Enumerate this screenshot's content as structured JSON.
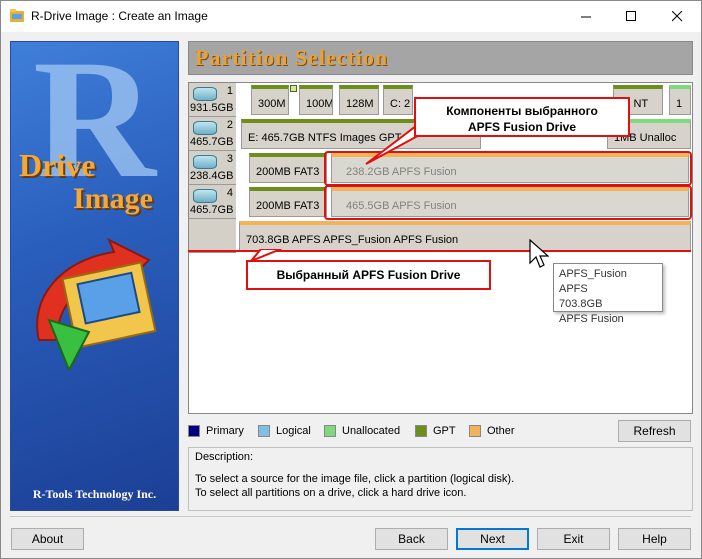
{
  "window": {
    "title": "R-Drive Image : Create an Image"
  },
  "sidebar": {
    "logo_r": "R",
    "logo_drive": "Drive",
    "logo_image": "Image",
    "company": "R-Tools Technology Inc."
  },
  "header": {
    "title": "Partition Selection"
  },
  "drives": [
    {
      "num": "1",
      "size": "931.5GB",
      "partitions": [
        "300M",
        "100M",
        "128M",
        "C: 2",
        "B: NT",
        "1"
      ]
    },
    {
      "num": "2",
      "size": "465.7GB",
      "partitions": [
        "E: 465.7GB  NTFS  Images GPT",
        "1MB  Unalloc"
      ]
    },
    {
      "num": "3",
      "size": "238.4GB",
      "partitions": [
        "200MB  FAT3",
        "238.2GB     APFS Fusion"
      ]
    },
    {
      "num": "4",
      "size": "465.7GB",
      "partitions": [
        "200MB  FAT3",
        "465.5GB     APFS Fusion"
      ]
    },
    {
      "num": "",
      "size": "",
      "partitions": [
        "703.8GB  APFS  APFS_Fusion APFS Fusion"
      ]
    }
  ],
  "annotations": {
    "components_line1": "Компоненты выбранного",
    "components_line2": "APFS Fusion Drive",
    "selected": "Выбранный APFS Fusion Drive"
  },
  "tooltip": {
    "line1": "APFS_Fusion APFS",
    "line2": "703.8GB",
    "line3": "APFS Fusion"
  },
  "legend": [
    {
      "label": "Primary",
      "color": "#000080"
    },
    {
      "label": "Logical",
      "color": "#7fbfe6"
    },
    {
      "label": "Unallocated",
      "color": "#7fd97f"
    },
    {
      "label": "GPT",
      "color": "#6b8f1a"
    },
    {
      "label": "Other",
      "color": "#f2b35a"
    }
  ],
  "refresh_label": "Refresh",
  "description": {
    "label": "Description:",
    "line1": "To select a source for the image file, click a partition (logical disk).",
    "line2": "To select all partitions on a drive, click a hard drive icon."
  },
  "buttons": {
    "about": "About",
    "back": "Back",
    "next": "Next",
    "exit": "Exit",
    "help": "Help"
  }
}
